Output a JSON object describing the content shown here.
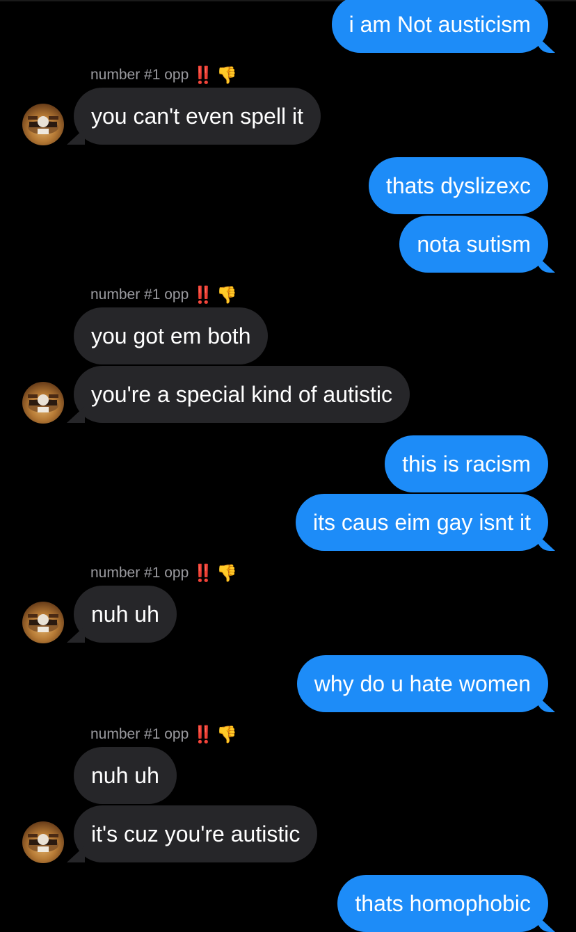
{
  "contact": {
    "name": "number #1 opp",
    "name_excl": "‼️",
    "name_emoji": "👎"
  },
  "messages": [
    {
      "from": "me",
      "text": "i am Not austicism"
    },
    {
      "from": "them",
      "text": "you can't even spell it"
    },
    {
      "from": "me",
      "text": "thats dyslizexc"
    },
    {
      "from": "me",
      "text": "nota sutism"
    },
    {
      "from": "them",
      "text": "you got em both"
    },
    {
      "from": "them",
      "text": "you're a special kind of autistic"
    },
    {
      "from": "me",
      "text": "this is racism"
    },
    {
      "from": "me",
      "text": "its caus eim gay isnt it"
    },
    {
      "from": "them",
      "text": "nuh uh"
    },
    {
      "from": "me",
      "text": "why do u hate women"
    },
    {
      "from": "them",
      "text": "nuh uh"
    },
    {
      "from": "them",
      "text": "it's cuz you're autistic"
    },
    {
      "from": "me",
      "text": "thats homophobic"
    }
  ],
  "colors": {
    "background": "#000000",
    "sent_bubble": "#1d8cf8",
    "received_bubble": "#262629",
    "sender_name": "#9a9a9f"
  },
  "icons": {
    "avatar": "contact-avatar-photo",
    "excl": "double-exclamation-emoji",
    "thumb": "thumbs-down-emoji"
  }
}
